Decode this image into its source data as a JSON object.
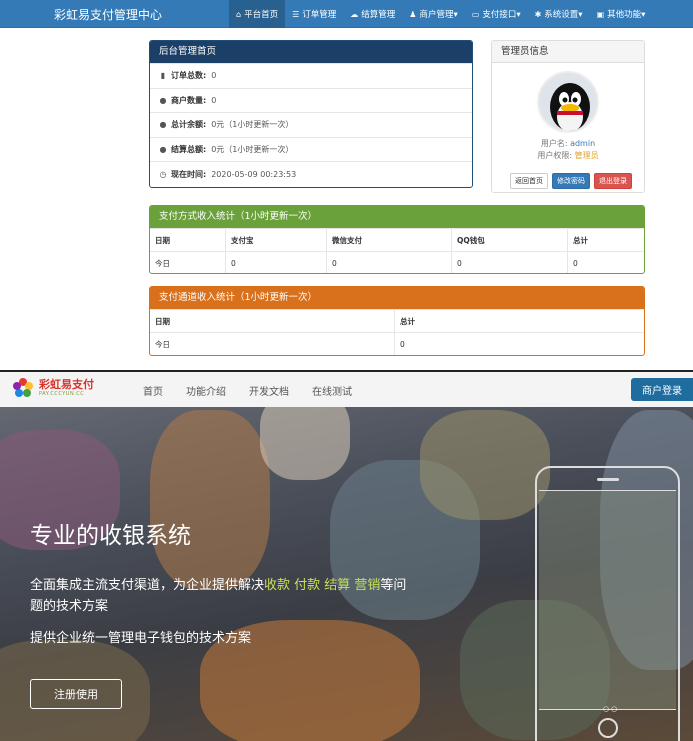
{
  "admin": {
    "brand": "彩虹易支付管理中心",
    "nav": [
      {
        "icon": "home-icon",
        "glyph": "⌂",
        "label": "平台首页",
        "active": true
      },
      {
        "icon": "list-icon",
        "glyph": "☰",
        "label": "订单管理"
      },
      {
        "icon": "cloud-icon",
        "glyph": "☁",
        "label": "结算管理"
      },
      {
        "icon": "user-icon",
        "glyph": "♟",
        "label": "商户管理▾"
      },
      {
        "icon": "card-icon",
        "glyph": "▭",
        "label": "支付接口▾"
      },
      {
        "icon": "gear-icon",
        "glyph": "✱",
        "label": "系统设置▾"
      },
      {
        "icon": "briefcase-icon",
        "glyph": "▣",
        "label": "其他功能▾"
      }
    ],
    "home_panel": {
      "title": "后台管理首页",
      "rows": [
        {
          "icon": "bar-chart-icon",
          "glyph": "▮",
          "label": "订单总数:",
          "value": "0"
        },
        {
          "icon": "drop-icon",
          "glyph": "●",
          "label": "商户数量:",
          "value": "0"
        },
        {
          "icon": "drop-icon",
          "glyph": "●",
          "label": "总计余额:",
          "value": "0元（1小时更新一次）"
        },
        {
          "icon": "drop-icon",
          "glyph": "●",
          "label": "结算总额:",
          "value": "0元（1小时更新一次）"
        },
        {
          "icon": "clock-icon",
          "glyph": "◷",
          "label": "现在时间:",
          "value": "2020-05-09 00:23:53"
        }
      ]
    },
    "user_panel": {
      "title": "管理员信息",
      "username_label": "用户名: ",
      "username": "admin",
      "role_label": "用户权限: ",
      "role": "管理员",
      "buttons": [
        "返回首页",
        "修改密码",
        "退出登录"
      ]
    },
    "pay_panel": {
      "title": "支付方式收入统计（1小时更新一次）",
      "headers": [
        "日期",
        "支付宝",
        "微信支付",
        "QQ钱包",
        "总计"
      ],
      "row": [
        "今日",
        "0",
        "0",
        "0",
        "0"
      ]
    },
    "channel_panel": {
      "title": "支付通道收入统计（1小时更新一次）",
      "headers": [
        "日期",
        "总计"
      ],
      "row": [
        "今日",
        "0"
      ]
    }
  },
  "landing": {
    "logo_text": "彩虹易支付",
    "logo_sub": "PAY.CCCYUN.CC",
    "nav": [
      "首页",
      "功能介绍",
      "开发文档",
      "在线测试"
    ],
    "login_button": "商户登录",
    "hero_title": "专业的收银系统",
    "hero_line1_prefix": "全面集成主流支付渠道，为企业提供解决",
    "hero_line1_highlight": "收款 付款 结算 营销",
    "hero_line1_suffix": "等问",
    "hero_line2": "题的技术方案",
    "hero_line3": "提供企业统一管理电子钱包的技术方案",
    "register_button": "注册使用",
    "phone_dots": "○○",
    "colors": {
      "admin_nav": "#337ab7",
      "home_header": "#1b3f66",
      "pay_header": "#6aa13a",
      "channel_header": "#d9701c",
      "login_btn": "#1f6c9e",
      "highlight": "#c6e05a"
    }
  }
}
